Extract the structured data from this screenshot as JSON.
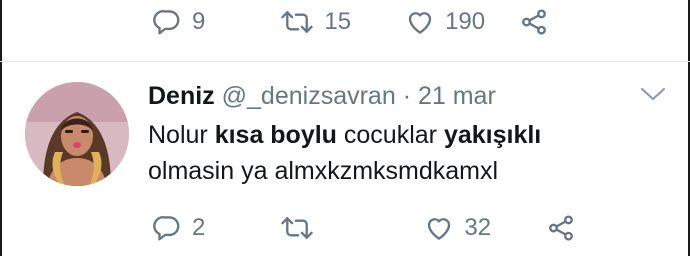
{
  "previous_tweet": {
    "actions": {
      "reply_count": "9",
      "retweet_count": "15",
      "like_count": "190"
    }
  },
  "tweet": {
    "display_name": "Deniz",
    "handle": "@_denizsavran",
    "separator": "·",
    "date": "21 mar",
    "text": {
      "part1": "Nolur ",
      "bold1": "kısa boylu",
      "part2": " cocuklar ",
      "bold2": "yakışıklı",
      "line2": "olmasin ya almxkzmksmdkamxl"
    },
    "actions": {
      "reply_count": "2",
      "retweet_count": "",
      "like_count": "32"
    }
  },
  "colors": {
    "icon_gray": "#657786",
    "divider": "#e1e8ed",
    "text": "#14171a"
  },
  "icons": [
    "reply-icon",
    "retweet-icon",
    "like-icon",
    "share-icon",
    "chevron-down-icon"
  ]
}
